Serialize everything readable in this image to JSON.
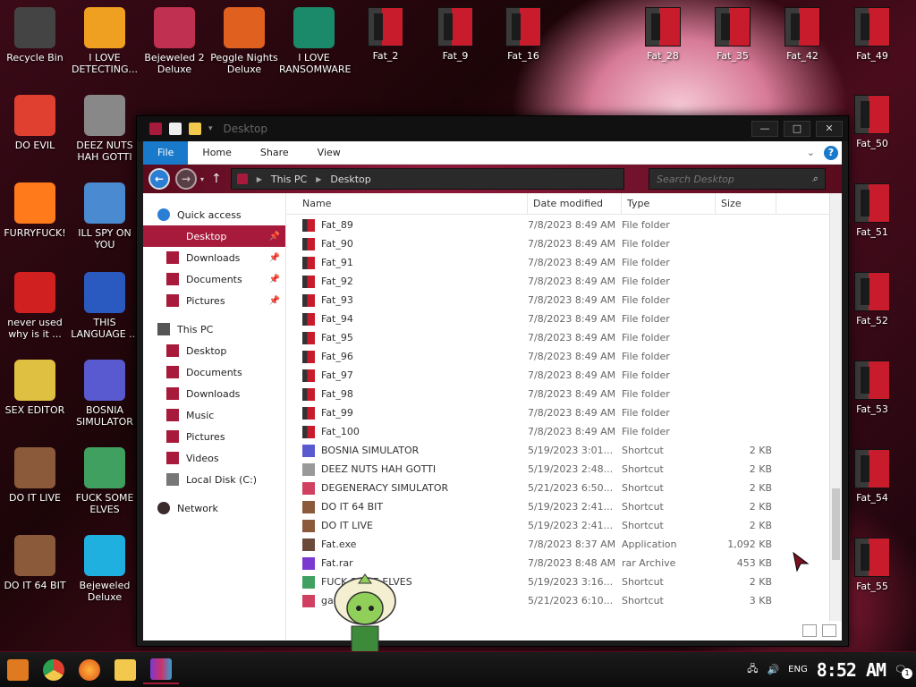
{
  "desktop": {
    "left_icons": [
      {
        "label": "Recycle Bin",
        "icon": "recycle-bin-icon",
        "color": "#444"
      },
      {
        "label": "I LOVE DETECTING...",
        "icon": "detect-it-easy-icon",
        "color": "#f0a020"
      },
      {
        "label": "Bejeweled 2 Deluxe",
        "icon": "bejeweled-2-icon",
        "color": "#c03050"
      },
      {
        "label": "Peggle Nights Deluxe",
        "icon": "peggle-icon",
        "color": "#e06020"
      },
      {
        "label": "I LOVE RANSOMWARE",
        "icon": "publisher-icon",
        "color": "#1a8a6a"
      },
      {
        "label": "DO EVIL",
        "icon": "chrome-icon",
        "color": "#e04030"
      },
      {
        "label": "DEEZ NUTS HAH GOTTI",
        "icon": "windows-stack-icon",
        "color": "#888"
      },
      {
        "label": "FURRYFUCK!",
        "icon": "firefox-icon",
        "color": "#ff7a1a"
      },
      {
        "label": "ILL SPY ON YOU",
        "icon": "network-spy-icon",
        "color": "#4a8ad0"
      },
      {
        "label": "never used why is it ...",
        "icon": "dev-cpp-icon",
        "color": "#d02020"
      },
      {
        "label": "THIS LANGUAGE ...",
        "icon": "goland-icon",
        "color": "#2a5ac0"
      },
      {
        "label": "SEX EDITOR",
        "icon": "hxd-icon",
        "color": "#e0c040"
      },
      {
        "label": "BOSNIA SIMULATOR",
        "icon": "mine-icon",
        "color": "#5a5ad0"
      },
      {
        "label": "DO IT LIVE",
        "icon": "portrait-icon",
        "color": "#8a5a3a"
      },
      {
        "label": "FUCK SOME ELVES",
        "icon": "santa-icon",
        "color": "#40a060"
      },
      {
        "label": "DO IT 64 BIT",
        "icon": "portrait-64-icon",
        "color": "#8a5a3a"
      },
      {
        "label": "Bejeweled Deluxe",
        "icon": "diamond-icon",
        "color": "#20b0e0"
      }
    ],
    "top_fat_icons": [
      "Fat_2",
      "Fat_9",
      "Fat_16",
      "Fat_28",
      "Fat_35",
      "Fat_42",
      "Fat_49"
    ],
    "right_fat_icons": [
      "Fat_50",
      "Fat_51",
      "Fat_52",
      "Fat_53",
      "Fat_54",
      "Fat_55"
    ]
  },
  "window": {
    "title": "Desktop",
    "controls": {
      "minimize": "—",
      "maximize": "□",
      "close": "✕"
    },
    "ribbon_tabs": [
      "File",
      "Home",
      "Share",
      "View"
    ],
    "help": "?",
    "expand": "⌄",
    "breadcrumb": [
      "This PC",
      "Desktop"
    ],
    "search_placeholder": "Search Desktop",
    "nav": [
      {
        "label": "Quick access",
        "level": 0,
        "icon": "star-icon",
        "pinned": false,
        "selected": false
      },
      {
        "label": "Desktop",
        "level": 1,
        "icon": "folder-icon",
        "pinned": true,
        "selected": true
      },
      {
        "label": "Downloads",
        "level": 1,
        "icon": "folder-icon",
        "pinned": true,
        "selected": false
      },
      {
        "label": "Documents",
        "level": 1,
        "icon": "folder-icon",
        "pinned": true,
        "selected": false
      },
      {
        "label": "Pictures",
        "level": 1,
        "icon": "folder-icon",
        "pinned": true,
        "selected": false
      },
      {
        "label": "This PC",
        "level": 0,
        "icon": "computer-icon",
        "pinned": false,
        "selected": false
      },
      {
        "label": "Desktop",
        "level": 1,
        "icon": "folder-icon",
        "pinned": false,
        "selected": false
      },
      {
        "label": "Documents",
        "level": 1,
        "icon": "folder-icon",
        "pinned": false,
        "selected": false
      },
      {
        "label": "Downloads",
        "level": 1,
        "icon": "folder-icon",
        "pinned": false,
        "selected": false
      },
      {
        "label": "Music",
        "level": 1,
        "icon": "folder-icon",
        "pinned": false,
        "selected": false
      },
      {
        "label": "Pictures",
        "level": 1,
        "icon": "folder-icon",
        "pinned": false,
        "selected": false
      },
      {
        "label": "Videos",
        "level": 1,
        "icon": "folder-icon",
        "pinned": false,
        "selected": false
      },
      {
        "label": "Local Disk (C:)",
        "level": 1,
        "icon": "drive-icon",
        "pinned": false,
        "selected": false
      },
      {
        "label": "Network",
        "level": 0,
        "icon": "network-icon",
        "pinned": false,
        "selected": false
      }
    ],
    "columns": [
      "Name",
      "Date modified",
      "Type",
      "Size"
    ],
    "files": [
      {
        "name": "Fat_89",
        "date": "7/8/2023 8:49 AM",
        "type": "File folder",
        "size": "",
        "icon": "fat-folder-icon"
      },
      {
        "name": "Fat_90",
        "date": "7/8/2023 8:49 AM",
        "type": "File folder",
        "size": "",
        "icon": "fat-folder-icon"
      },
      {
        "name": "Fat_91",
        "date": "7/8/2023 8:49 AM",
        "type": "File folder",
        "size": "",
        "icon": "fat-folder-icon"
      },
      {
        "name": "Fat_92",
        "date": "7/8/2023 8:49 AM",
        "type": "File folder",
        "size": "",
        "icon": "fat-folder-icon"
      },
      {
        "name": "Fat_93",
        "date": "7/8/2023 8:49 AM",
        "type": "File folder",
        "size": "",
        "icon": "fat-folder-icon"
      },
      {
        "name": "Fat_94",
        "date": "7/8/2023 8:49 AM",
        "type": "File folder",
        "size": "",
        "icon": "fat-folder-icon"
      },
      {
        "name": "Fat_95",
        "date": "7/8/2023 8:49 AM",
        "type": "File folder",
        "size": "",
        "icon": "fat-folder-icon"
      },
      {
        "name": "Fat_96",
        "date": "7/8/2023 8:49 AM",
        "type": "File folder",
        "size": "",
        "icon": "fat-folder-icon"
      },
      {
        "name": "Fat_97",
        "date": "7/8/2023 8:49 AM",
        "type": "File folder",
        "size": "",
        "icon": "fat-folder-icon"
      },
      {
        "name": "Fat_98",
        "date": "7/8/2023 8:49 AM",
        "type": "File folder",
        "size": "",
        "icon": "fat-folder-icon"
      },
      {
        "name": "Fat_99",
        "date": "7/8/2023 8:49 AM",
        "type": "File folder",
        "size": "",
        "icon": "fat-folder-icon"
      },
      {
        "name": "Fat_100",
        "date": "7/8/2023 8:49 AM",
        "type": "File folder",
        "size": "",
        "icon": "fat-folder-icon"
      },
      {
        "name": "BOSNIA SIMULATOR",
        "date": "5/19/2023 3:01...",
        "type": "Shortcut",
        "size": "2 KB",
        "icon": "mine-icon"
      },
      {
        "name": "DEEZ NUTS HAH GOTTI",
        "date": "5/19/2023 2:48...",
        "type": "Shortcut",
        "size": "2 KB",
        "icon": "windows-stack-icon"
      },
      {
        "name": "DEGENERACY SIMULATOR",
        "date": "5/21/2023 6:50...",
        "type": "Shortcut",
        "size": "2 KB",
        "icon": "game-icon"
      },
      {
        "name": "DO IT 64 BIT",
        "date": "5/19/2023 2:41...",
        "type": "Shortcut",
        "size": "2 KB",
        "icon": "portrait-icon"
      },
      {
        "name": "DO IT LIVE",
        "date": "5/19/2023 2:41...",
        "type": "Shortcut",
        "size": "2 KB",
        "icon": "portrait-icon"
      },
      {
        "name": "Fat.exe",
        "date": "7/8/2023 8:37 AM",
        "type": "Application",
        "size": "1,092 KB",
        "icon": "app-icon"
      },
      {
        "name": "Fat.rar",
        "date": "7/8/2023 8:48 AM",
        "type": "rar Archive",
        "size": "453 KB",
        "icon": "rar-icon"
      },
      {
        "name": "FUCK SOME ELVES",
        "date": "5/19/2023 3:16...",
        "type": "Shortcut",
        "size": "2 KB",
        "icon": "santa-icon"
      },
      {
        "name": "ga...",
        "date": "5/21/2023 6:10...",
        "type": "Shortcut",
        "size": "3 KB",
        "icon": "game-icon"
      }
    ]
  },
  "taskbar": {
    "apps": [
      "start-icon",
      "chrome-icon",
      "firefox-icon",
      "explorer-icon",
      "winrar-icon"
    ],
    "lang": "ENG",
    "time": "8:52 AM",
    "notifications": "1"
  },
  "colors": {
    "accent": "#a81a3b",
    "file_tab": "#1979ca"
  }
}
